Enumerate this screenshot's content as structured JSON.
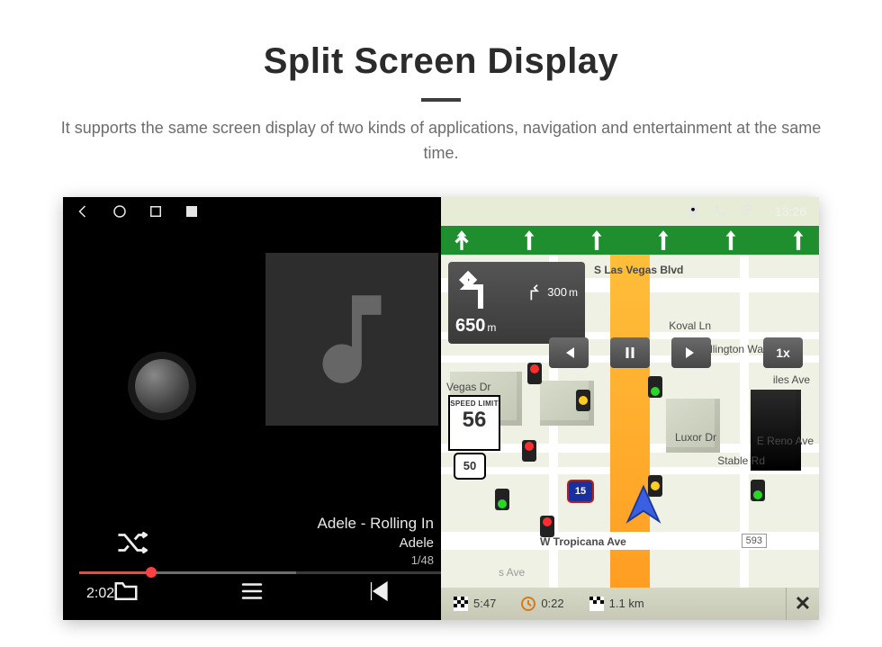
{
  "header": {
    "title": "Split Screen Display",
    "subtitle": "It supports the same screen display of two kinds of applications, navigation and entertainment at the same time."
  },
  "statusbar": {
    "time": "13:26"
  },
  "music": {
    "track_title": "Adele - Rolling In",
    "artist": "Adele",
    "counter": "1/48",
    "elapsed": "2:02"
  },
  "nav": {
    "turn": {
      "distance": "650",
      "unit": "m"
    },
    "next_turn": {
      "distance": "300",
      "unit": "m"
    },
    "speed_multiplier": "1x",
    "speed_limit": {
      "label": "SPEED LIMIT",
      "value": "56"
    },
    "route50": "50",
    "route15": "15",
    "tropicana_dist": "593",
    "roads": {
      "s_las_vegas": "S Las Vegas Blvd",
      "koval": "Koval Ln",
      "duke": "Duke Ellington Way",
      "vegas_dr": "Vegas Dr",
      "luxor": "Luxor Dr",
      "stable": "Stable Rd",
      "reno": "E Reno Ave",
      "tropicana": "W Tropicana Ave",
      "iles": "iles Ave",
      "s_ave": "s Ave"
    },
    "bottom": {
      "eta": "5:47",
      "duration": "0:22",
      "remaining": "1.1",
      "remaining_unit": "km"
    }
  }
}
